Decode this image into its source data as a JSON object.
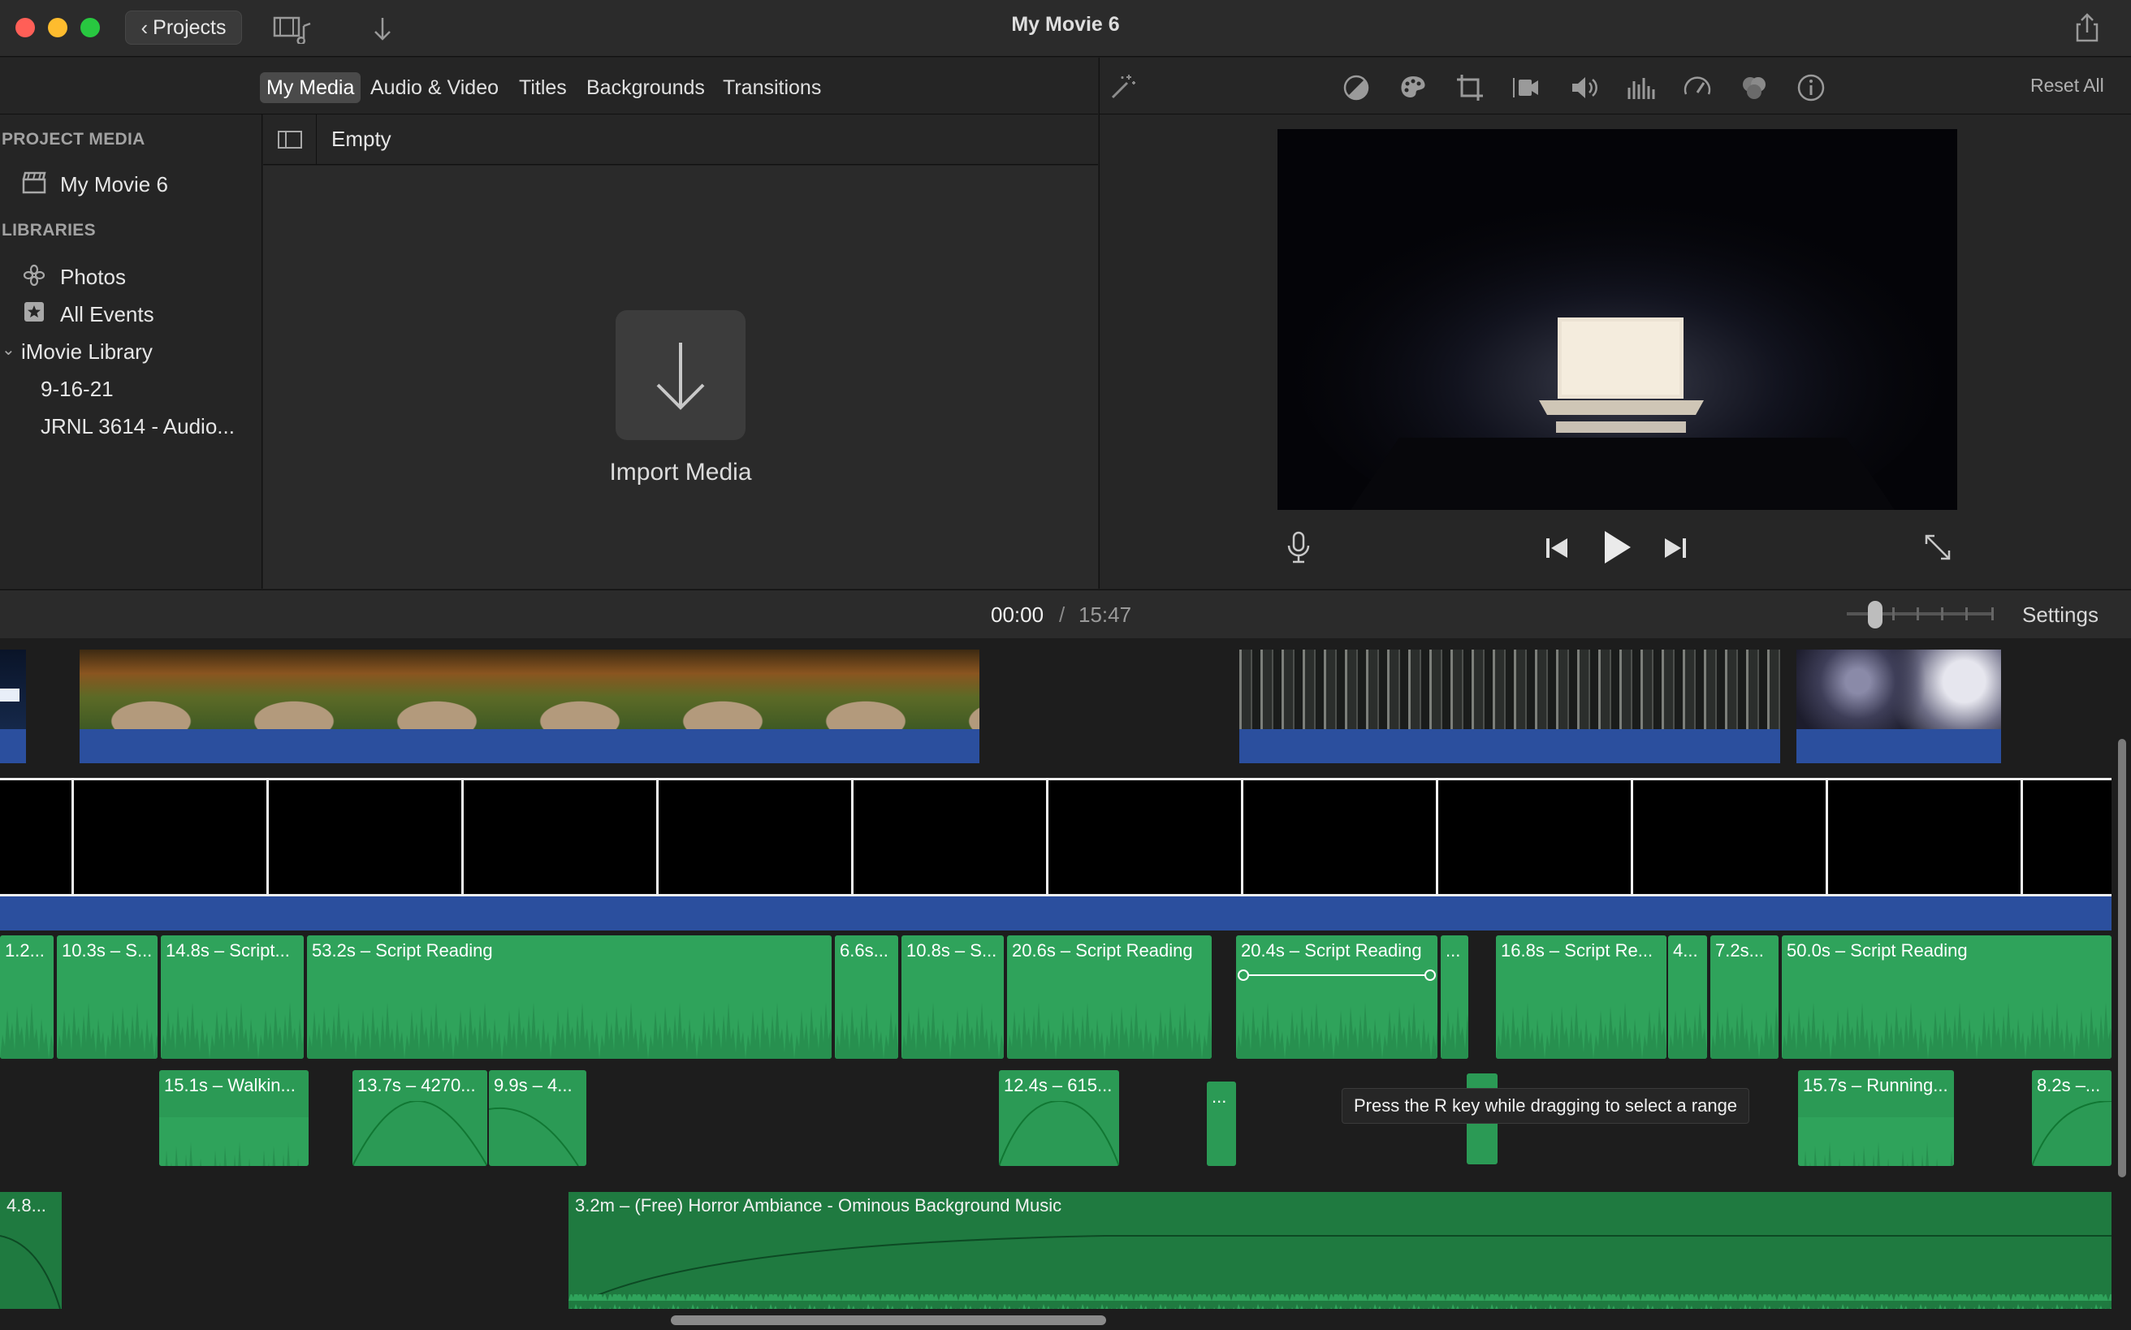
{
  "window": {
    "title": "My Movie 6",
    "projects_label": "Projects"
  },
  "browser_tabs": [
    "My Media",
    "Audio & Video",
    "Titles",
    "Backgrounds",
    "Transitions"
  ],
  "viewer_toolbar": {
    "tools": [
      "color-balance-icon",
      "color-palette-icon",
      "crop-icon",
      "stabilization-icon",
      "volume-icon",
      "noise-reduction-icon",
      "speed-icon",
      "clip-filter-icon",
      "info-icon"
    ],
    "reset_all": "Reset All"
  },
  "sidebar": {
    "project_media_header": "PROJECT MEDIA",
    "project_item": "My Movie 6",
    "libraries_header": "LIBRARIES",
    "photos": "Photos",
    "all_events": "All Events",
    "library": "iMovie Library",
    "events": [
      "9-16-21",
      "JRNL 3614 - Audio..."
    ]
  },
  "media": {
    "filter": "Empty",
    "import_label": "Import Media"
  },
  "timeline": {
    "current_time": "00:00",
    "separator": "/",
    "total_time": "15:47",
    "settings": "Settings",
    "audio_row1": [
      "1.2...",
      "10.3s – S...",
      "14.8s – Script...",
      "53.2s – Script Reading",
      "6.6s...",
      "10.8s – S...",
      "20.6s – Script Reading",
      "20.4s – Script Reading",
      "...",
      "16.8s – Script Re...",
      "4...",
      "7.2s...",
      "50.0s – Script Reading"
    ],
    "audio_row2": [
      "15.1s – Walkin...",
      "13.7s – 4270...",
      "9.9s – 4...",
      "12.4s – 615...",
      "...",
      "...",
      "15.7s – Running...",
      "8.2s –..."
    ],
    "music": [
      "4.8...",
      "3.2m – (Free) Horror Ambiance - Ominous Background Music"
    ],
    "tooltip": "Press the R key while dragging to select a range"
  },
  "colors": {
    "audio_green": "#2fa35b",
    "music_green": "#1f7a40",
    "video_blue": "#2b4f9e"
  }
}
